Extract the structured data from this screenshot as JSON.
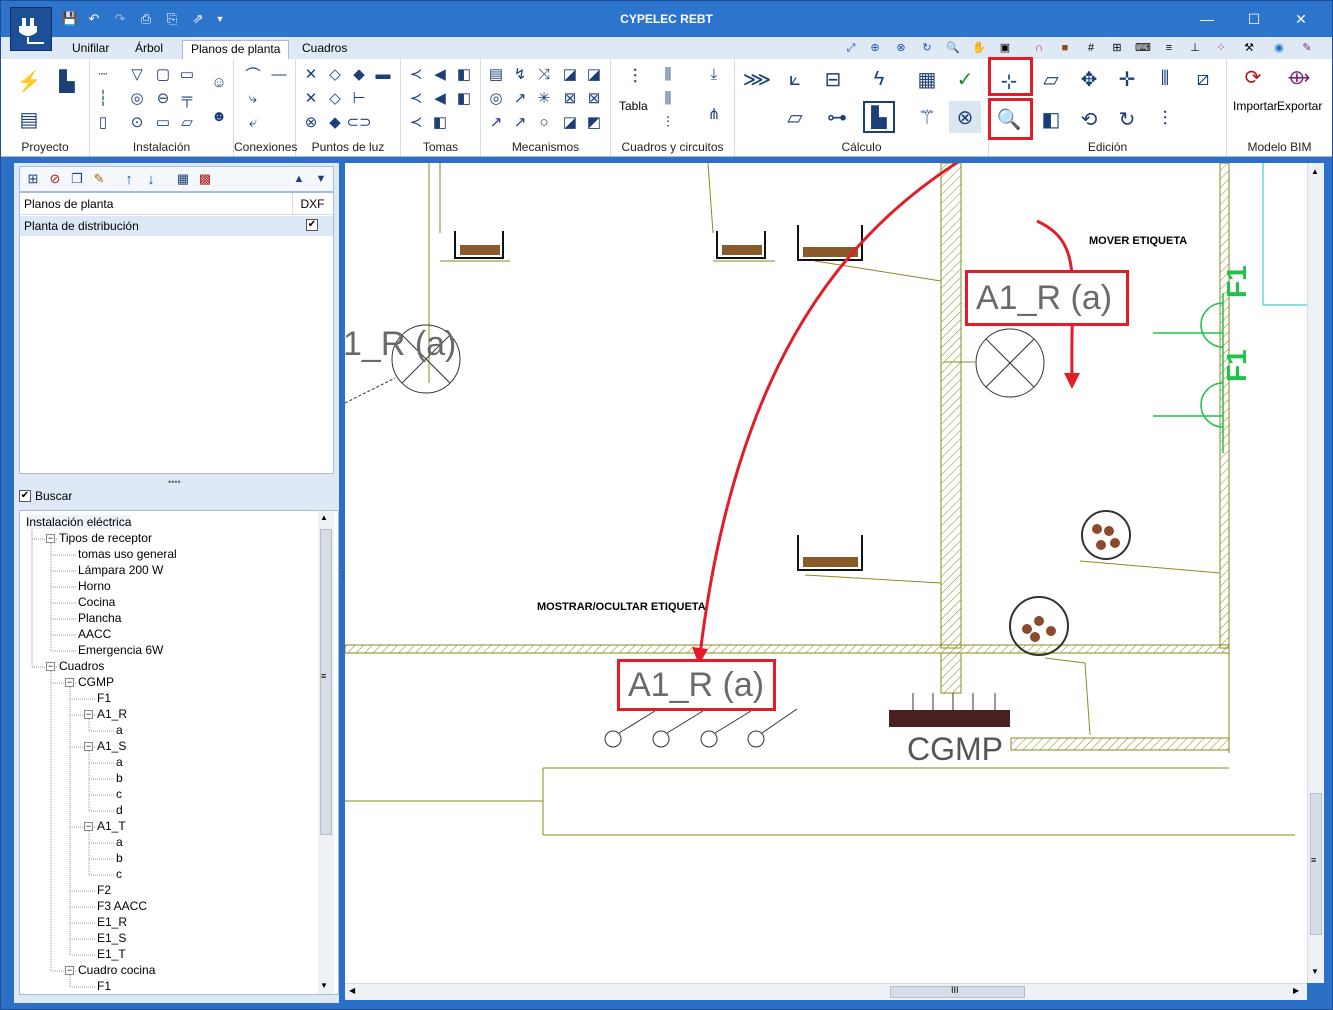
{
  "app": {
    "title": "CYPELEC REBT"
  },
  "menu_tabs": [
    "Unifilar",
    "Árbol",
    "Planos de planta",
    "Cuadros"
  ],
  "ribbon_groups": [
    "Proyecto",
    "Instalación",
    "Conexiones",
    "Puntos de luz",
    "Tomas",
    "Mecanismos",
    "Cuadros y circuitos",
    "Cálculo",
    "Edición",
    "Modelo BIM"
  ],
  "ribbon_labels": {
    "tabla": "Tabla",
    "importar": "Importar",
    "exportar": "Exportar"
  },
  "plan_list": {
    "headers": [
      "Planos de planta",
      "DXF"
    ],
    "rows": [
      {
        "name": "Planta de distribución",
        "dxf": true
      }
    ]
  },
  "search": {
    "label": "Buscar",
    "checked": true
  },
  "tree": [
    {
      "label": "Instalación eléctrica",
      "level": 0
    },
    {
      "label": "Tipos de receptor",
      "level": 1
    },
    {
      "label": "tomas uso general",
      "level": 2
    },
    {
      "label": "Lámpara 200 W",
      "level": 2
    },
    {
      "label": "Horno",
      "level": 2
    },
    {
      "label": "Cocina",
      "level": 2
    },
    {
      "label": "Plancha",
      "level": 2
    },
    {
      "label": "AACC",
      "level": 2
    },
    {
      "label": "Emergencia 6W",
      "level": 2
    },
    {
      "label": "Cuadros",
      "level": 1
    },
    {
      "label": "CGMP",
      "level": 2
    },
    {
      "label": "F1",
      "level": 3
    },
    {
      "label": "A1_R",
      "level": 3
    },
    {
      "label": "a",
      "level": 4
    },
    {
      "label": "A1_S",
      "level": 3
    },
    {
      "label": "a",
      "level": 4
    },
    {
      "label": "b",
      "level": 4
    },
    {
      "label": "c",
      "level": 4
    },
    {
      "label": "d",
      "level": 4
    },
    {
      "label": "A1_T",
      "level": 3
    },
    {
      "label": "a",
      "level": 4
    },
    {
      "label": "b",
      "level": 4
    },
    {
      "label": "c",
      "level": 4
    },
    {
      "label": "F2",
      "level": 3
    },
    {
      "label": "F3 AACC",
      "level": 3
    },
    {
      "label": "E1_R",
      "level": 3
    },
    {
      "label": "E1_S",
      "level": 3
    },
    {
      "label": "E1_T",
      "level": 3
    },
    {
      "label": "Cuadro cocina",
      "level": 2
    },
    {
      "label": "F1",
      "level": 3
    }
  ],
  "canvas": {
    "label_partial": "1_R (a)",
    "label_moved": "A1_R (a)",
    "label_shown": "A1_R (a)",
    "annotation_move": "MOVER ETIQUETA",
    "annotation_show": "MOSTRAR/OCULTAR ETIQUETA",
    "panel_name": "CGMP",
    "f1_a": "F1",
    "f1_b": "F1"
  },
  "colors": {
    "titlebar": "#2d74cc",
    "highlight": "#e21c28",
    "wall": "#8a8a20",
    "f1_green": "#21c24a"
  },
  "scroll": {
    "grip": "III",
    "grip_v": "≡"
  }
}
